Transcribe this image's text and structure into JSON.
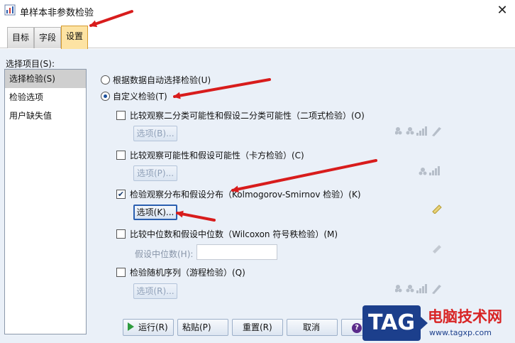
{
  "window": {
    "title": "单样本非参数检验",
    "close_glyph": "✕"
  },
  "tabs": [
    {
      "label": "目标"
    },
    {
      "label": "字段"
    },
    {
      "label": "设置"
    }
  ],
  "sidebar": {
    "label": "选择项目(S):",
    "items": [
      "选择检验(S)",
      "检验选项",
      "用户缺失值"
    ]
  },
  "mode": {
    "auto": "根据数据自动选择检验(U)",
    "custom": "自定义检验(T)",
    "selected": "custom"
  },
  "tests": [
    {
      "label": "比较观察二分类可能性和假设二分类可能性（二项式检验）(O)",
      "checked": false,
      "options": "选项(B)..."
    },
    {
      "label": "比较观察可能性和假设可能性（卡方检验）(C)",
      "checked": false,
      "options": "选项(P)..."
    },
    {
      "label": "检验观察分布和假设分布（Kolmogorov-Smirnov 检验）(K)",
      "checked": true,
      "options": "选项(K)..."
    },
    {
      "label": "比较中位数和假设中位数（Wilcoxon 符号秩检验）(M)",
      "checked": false
    },
    {
      "label": "检验随机序列（游程检验）(Q)",
      "checked": false,
      "options": "选项(R)..."
    }
  ],
  "hypothesized_median": {
    "label": "假设中位数(H):",
    "value": ""
  },
  "check_glyph": "✔",
  "buttons": {
    "run": "运行(R)",
    "paste": "粘贴(P)",
    "reset": "重置(R)",
    "cancel": "取消",
    "help_glyph": "?"
  },
  "watermark": {
    "tag": "TAG",
    "title": "电脑技术网",
    "url": "www.tagxp.com"
  },
  "colors": {
    "active_tab": "#fde3a3",
    "dialog_bg": "#eaf0f8",
    "arrow_red": "#d81c1c",
    "watermark_blue": "#1c3f8c"
  }
}
